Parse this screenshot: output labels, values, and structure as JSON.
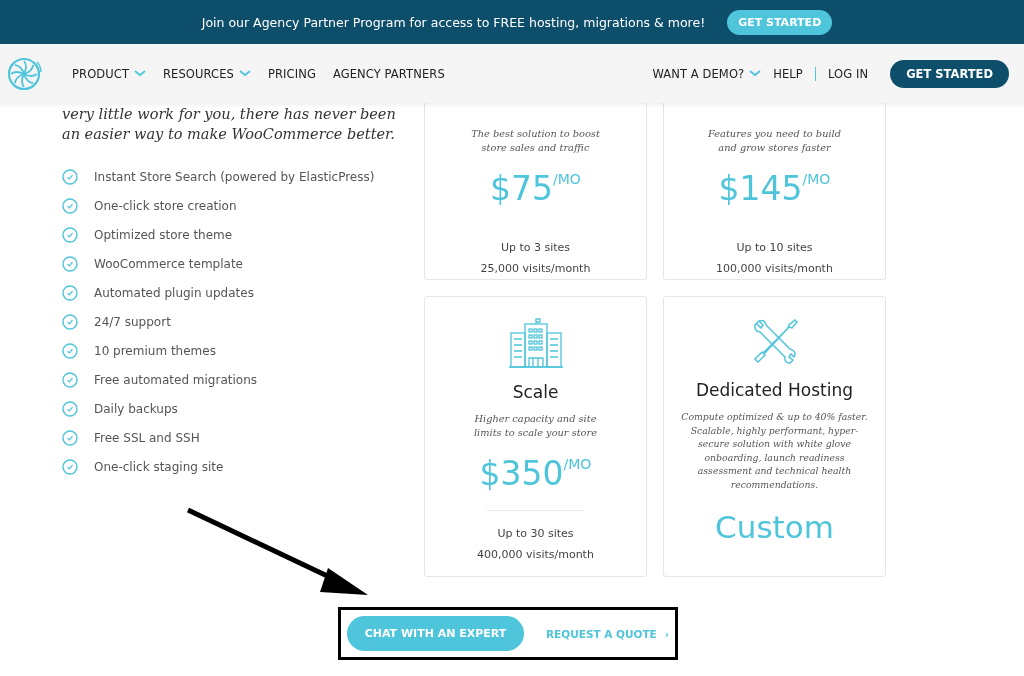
{
  "banner": {
    "text": "Join our Agency Partner Program for access to FREE hosting, migrations & more!",
    "button": "GET STARTED"
  },
  "nav": {
    "items": [
      {
        "label": "PRODUCT",
        "has_menu": true
      },
      {
        "label": "RESOURCES",
        "has_menu": true
      },
      {
        "label": "PRICING",
        "has_menu": false
      },
      {
        "label": "AGENCY PARTNERS",
        "has_menu": false
      }
    ],
    "right_items": [
      {
        "label": "WANT A DEMO?",
        "has_menu": true
      },
      {
        "label": "HELP",
        "has_menu": false
      },
      {
        "label": "LOG IN",
        "has_menu": false
      }
    ],
    "button": "GET STARTED"
  },
  "intro": [
    "very little work for you, there has never been",
    "an easier way to make WooCommerce better."
  ],
  "features": [
    "Instant Store Search (powered by ElasticPress)",
    "One-click store creation",
    "Optimized store theme",
    "WooCommerce template",
    "Automated plugin updates",
    "24/7 support",
    "10 premium themes",
    "Free automated migrations",
    "Daily backups",
    "Free SSL and SSH",
    "One-click staging site"
  ],
  "plans": [
    {
      "kind": "price",
      "tagline": [
        "The best solution to boost",
        "store sales and traffic"
      ],
      "price": "$75",
      "unit": "/MO",
      "sites": "Up to 3 sites",
      "visits": "25,000 visits/month"
    },
    {
      "kind": "price",
      "tagline": [
        "Features you need to build",
        "and grow stores faster"
      ],
      "price": "$145",
      "unit": "/MO",
      "sites": "Up to 10 sites",
      "visits": "100,000 visits/month"
    },
    {
      "kind": "price",
      "title": "Scale",
      "tagline": [
        "Higher capacity and site",
        "limits to scale your store"
      ],
      "price": "$350",
      "unit": "/MO",
      "sites": "Up to 30 sites",
      "visits": "400,000 visits/month"
    },
    {
      "kind": "custom",
      "title": "Dedicated Hosting",
      "tagline": [
        "Compute optimized & up to 40% faster.",
        "Scalable, highly performant, hyper-",
        "secure solution with white glove",
        "onboarding, launch readiness",
        "assessment and technical health",
        "recommendations."
      ],
      "price": "Custom"
    }
  ],
  "actions": {
    "primary": "CHAT WITH AN EXPERT",
    "secondary": "REQUEST A QUOTE",
    "secondary_arrow": "›"
  }
}
